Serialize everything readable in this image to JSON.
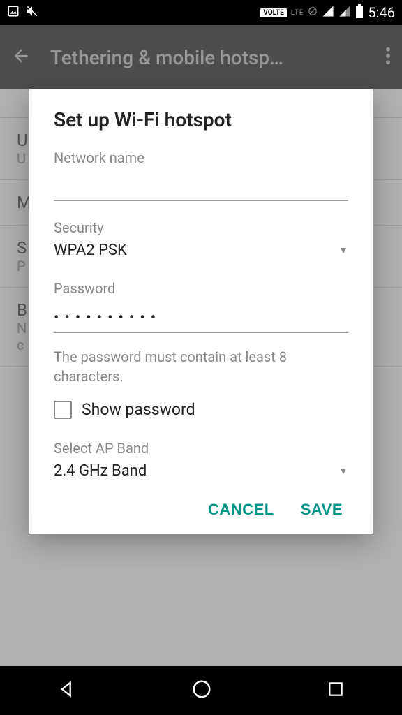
{
  "status": {
    "time": "5:46",
    "volte": "VOLTE",
    "lte": "LTE"
  },
  "appbar": {
    "title": "Tethering & mobile hotsp…"
  },
  "background": {
    "item1_a": "U",
    "item1_b": "U",
    "item2_a": "M",
    "item3_a": "S",
    "item3_b": "P",
    "item4_a": "B",
    "item4_b": "N",
    "item4_c": "c"
  },
  "dialog": {
    "title": "Set up Wi-Fi hotspot",
    "network_name_label": "Network name",
    "network_name_value": "",
    "security_label": "Security",
    "security_value": "WPA2 PSK",
    "password_label": "Password",
    "password_value": "••••••••••",
    "password_hint": "The password must contain at least 8 characters.",
    "show_password_label": "Show password",
    "show_password_checked": false,
    "ap_band_label": "Select AP Band",
    "ap_band_value": "2.4 GHz Band",
    "cancel": "CANCEL",
    "save": "SAVE"
  },
  "colors": {
    "accent": "#009688"
  }
}
